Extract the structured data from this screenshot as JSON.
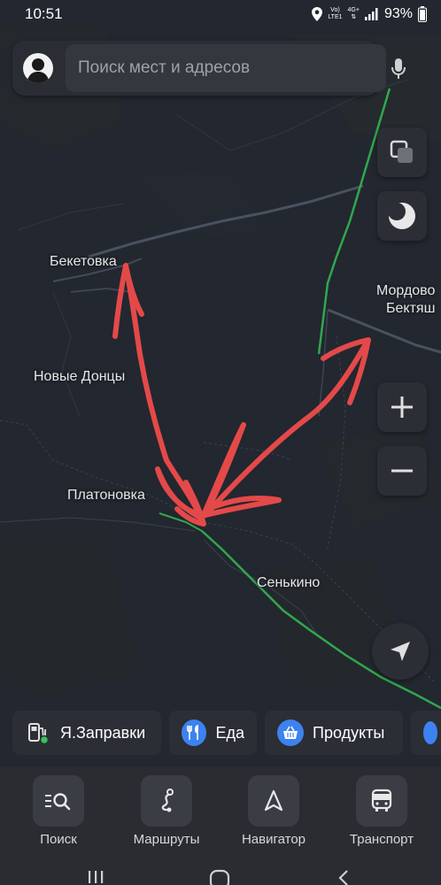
{
  "status": {
    "time": "10:51",
    "network_top": "Vo)",
    "network_bottom": "LTE1",
    "network_type": "4G+",
    "battery": "93%"
  },
  "search": {
    "placeholder": "Поиск мест и адресов"
  },
  "map": {
    "places": {
      "beketovka": "Бекетовка",
      "novye_dontsy": "Новые Донцы",
      "platonovka": "Платоновка",
      "senkino": "Сенькино",
      "mordovo": "Мордово",
      "bektyash": "Бектяш"
    }
  },
  "chips": [
    {
      "label": "Я.Заправки",
      "icon": "fuel-station-icon",
      "color": "#2b2e35"
    },
    {
      "label": "Еда",
      "icon": "cutlery-icon",
      "color": "#3d82f0"
    },
    {
      "label": "Продукты",
      "icon": "basket-icon",
      "color": "#3d82f0"
    }
  ],
  "tabs": [
    {
      "label": "Поиск",
      "icon": "search-list-icon"
    },
    {
      "label": "Маршруты",
      "icon": "route-icon"
    },
    {
      "label": "Навигатор",
      "icon": "navigator-arrow-icon"
    },
    {
      "label": "Транспорт",
      "icon": "bus-icon"
    }
  ],
  "colors": {
    "map_bg": "#23272f",
    "road": "#4a5160",
    "highway": "#2fa84f",
    "annotation": "#ef4b4b"
  }
}
